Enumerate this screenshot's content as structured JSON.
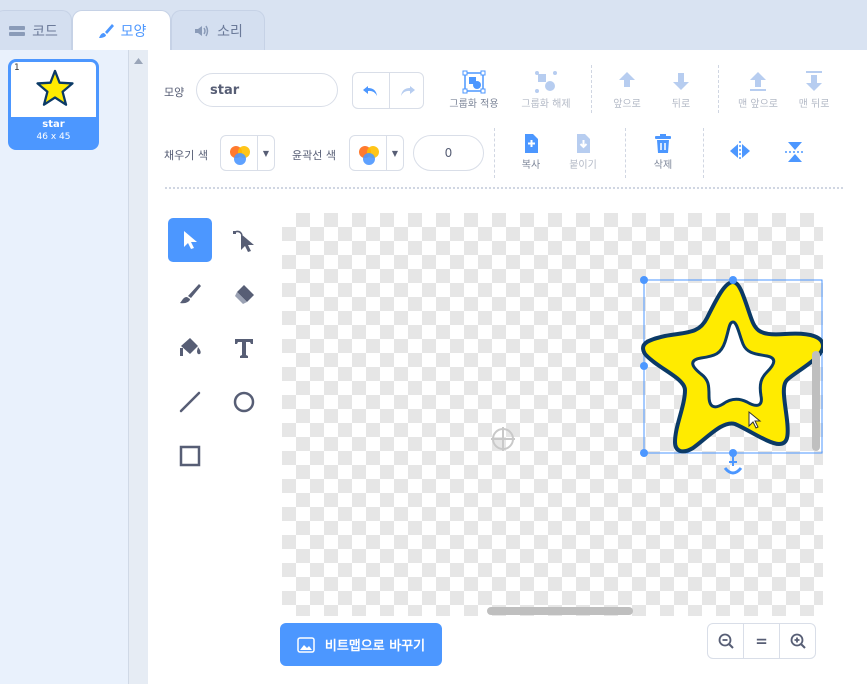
{
  "tabs": [
    {
      "label": "코드",
      "icon": "code-blocks-icon",
      "active": false
    },
    {
      "label": "모양",
      "icon": "brush-icon",
      "active": true
    },
    {
      "label": "소리",
      "icon": "speaker-icon",
      "active": false
    }
  ],
  "costume_list": {
    "items": [
      {
        "number": "1",
        "name": "star",
        "size": "46 x 45",
        "selected": true
      }
    ]
  },
  "toolbar": {
    "costume_label": "모양",
    "costume_name": "star",
    "group_label": "그룹화 적용",
    "ungroup_label": "그룹화 해제",
    "forward_label": "앞으로",
    "backward_label": "뒤로",
    "front_label": "맨 앞으로",
    "back_label": "맨 뒤로",
    "fill_label": "채우기 색",
    "outline_label": "윤곽선 색",
    "outline_width": "0",
    "copy_label": "복사",
    "paste_label": "붙이기",
    "delete_label": "삭제"
  },
  "bottom": {
    "convert_bitmap_label": "비트맵으로 바꾸기",
    "zoom_reset_label": "="
  },
  "colors": {
    "accent": "#4c97ff",
    "star_fill": "#ffeb00",
    "star_outline": "#0b3a66",
    "tab_bar": "#d9e3f2"
  }
}
